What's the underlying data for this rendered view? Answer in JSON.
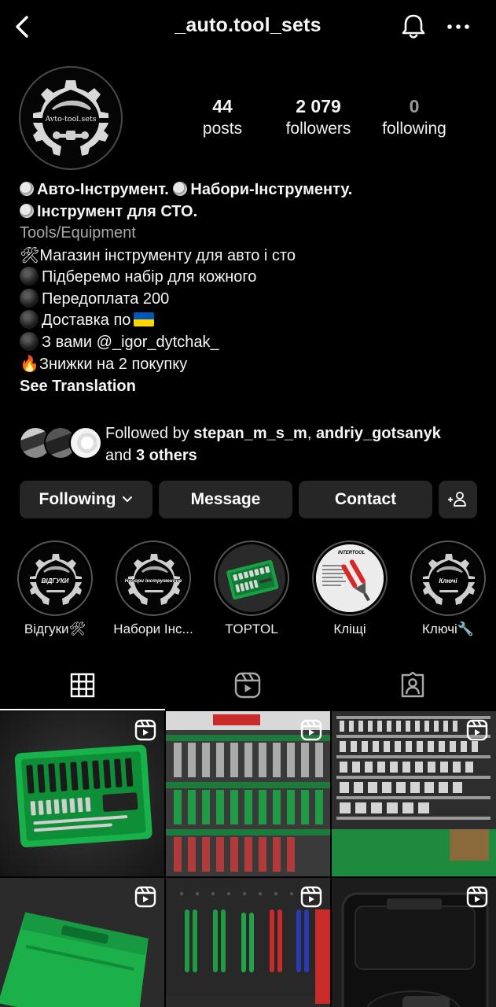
{
  "header": {
    "username": "_auto.tool_sets"
  },
  "avatar": {
    "text": "Avto-tool.sets"
  },
  "stats": [
    {
      "value": "44",
      "label": "posts"
    },
    {
      "value": "2 079",
      "label": "followers"
    },
    {
      "value": "0",
      "label": "following"
    }
  ],
  "bio": {
    "title_part1": "Авто-Інструмент.",
    "title_part2": "Набори-Інструменту.",
    "title_part3": "Інструмент для СТО.",
    "category": "Tools/Equipment",
    "lines": [
      "Магазин інструменту для авто і сто",
      "Підберемо набір для кожного",
      "Передоплата 200",
      "Доставка по",
      "З вами @_igor_dytchak_",
      "Знижки на 2 покупку"
    ],
    "see_translation": "See Translation"
  },
  "followed_by": {
    "prefix": "Followed by ",
    "user1": "stepan_m_s_m",
    "sep": ", ",
    "user2": "andriy_gotsanyk",
    "and": "and ",
    "others": "3 others"
  },
  "actions": {
    "following": "Following",
    "message": "Message",
    "contact": "Contact"
  },
  "highlights": [
    {
      "label": "Відгуки🛠",
      "inner": "ВІДГУКИ"
    },
    {
      "label": "Набори Інс...",
      "inner": "Набори інструментів"
    },
    {
      "label": "TOPTOL",
      "inner": ""
    },
    {
      "label": "Кліщі",
      "inner": "INTERTOOL"
    },
    {
      "label": "Ключі🔧",
      "inner": "Ключі"
    }
  ],
  "colors": {
    "accent_green": "#22b24c",
    "button_bg": "#262626",
    "flag_blue": "#0057b7",
    "flag_yellow": "#ffd700"
  }
}
